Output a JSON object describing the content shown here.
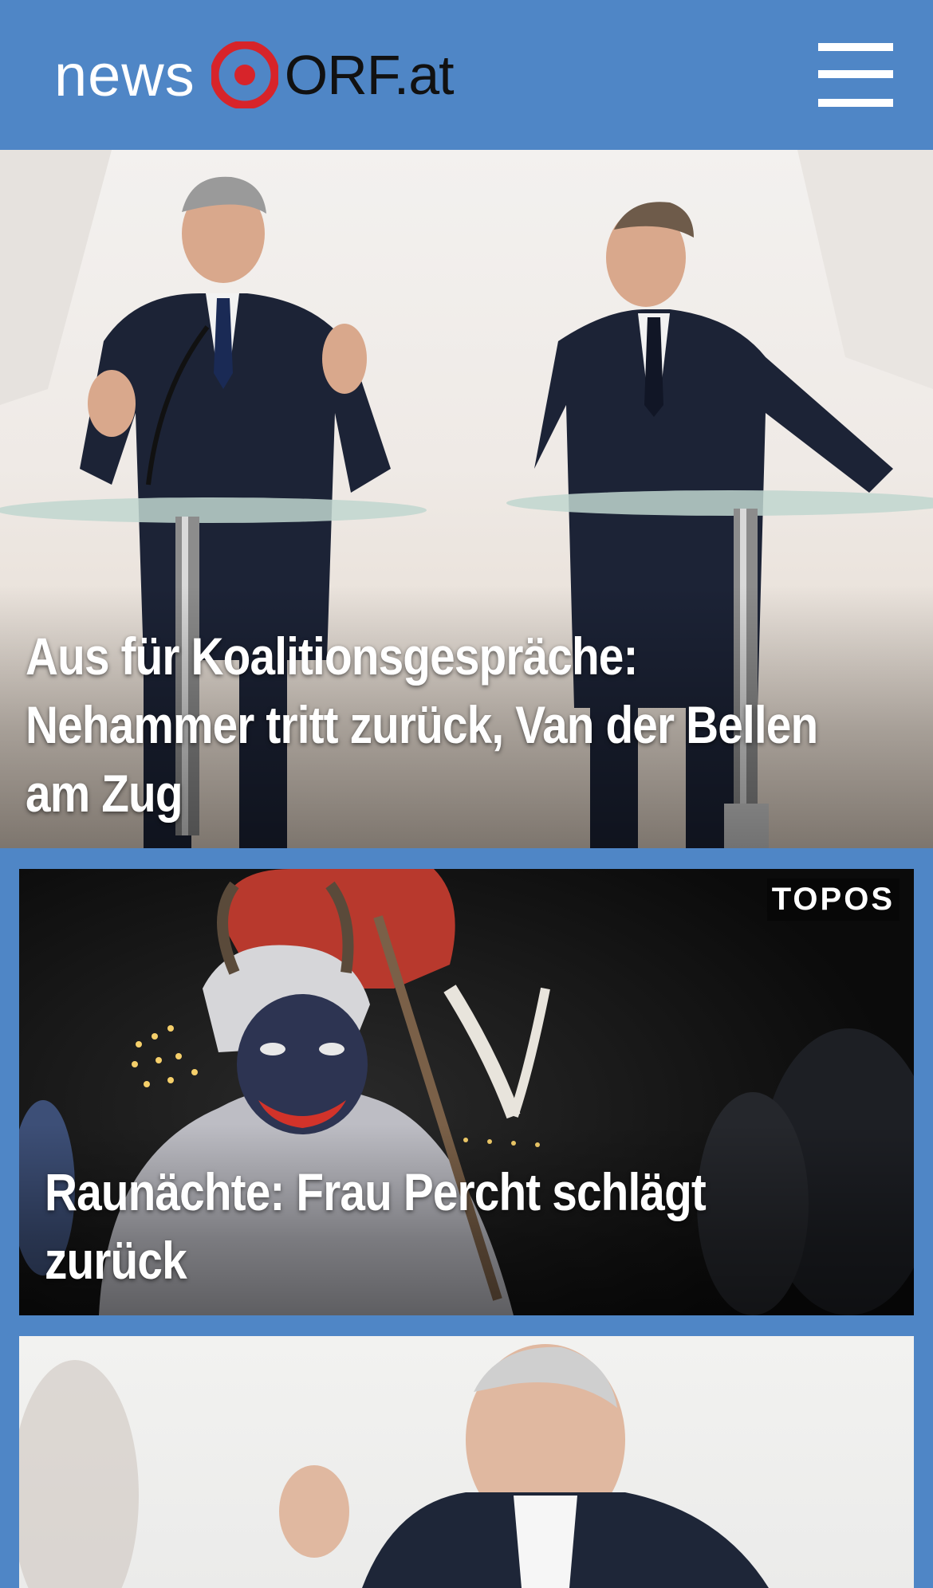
{
  "header": {
    "logo_news": "news",
    "logo_orf": "ORF.at",
    "menu_icon": "hamburger-menu-icon",
    "background": "#4f86c6",
    "accent": "#d7242a"
  },
  "articles": [
    {
      "headline": "Aus für Koalitionsgespräche: Nehammer tritt zurück, Van der Bellen am Zug",
      "badge": ""
    },
    {
      "headline": "Raunächte: Frau Percht schlägt zurück",
      "badge": "TOPOS"
    },
    {
      "headline": "",
      "badge": ""
    }
  ]
}
